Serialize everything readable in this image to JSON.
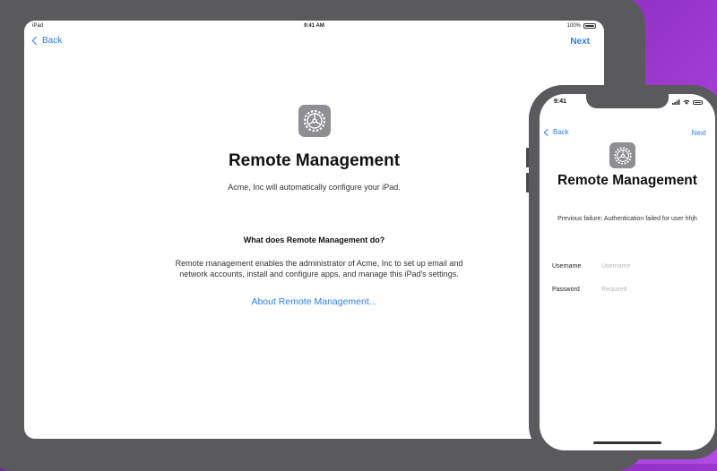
{
  "ipad": {
    "status": {
      "device": "iPad",
      "time": "9:41 AM",
      "battery": "100%"
    },
    "nav": {
      "back": "Back",
      "next": "Next"
    },
    "icon": "settings-gear-icon",
    "title": "Remote Management",
    "subtitle": "Acme, Inc will automatically configure your iPad.",
    "question": "What does Remote Management do?",
    "description": "Remote management enables the administrator of Acme, Inc to set up email and network accounts, install and configure apps, and manage this iPad's settings.",
    "link": "About Remote Management..."
  },
  "iphone": {
    "status": {
      "time": "9:41"
    },
    "nav": {
      "back": "Back",
      "next": "Next"
    },
    "icon": "settings-gear-icon",
    "title": "Remote Management",
    "failure": "Previous failure: Authentication failed for user hhjh",
    "fields": [
      {
        "label": "Username",
        "placeholder": "Username",
        "value": ""
      },
      {
        "label": "Password",
        "placeholder": "Required",
        "value": ""
      }
    ]
  },
  "colors": {
    "accent": "#2f7ef0",
    "background": "#8b2bc0",
    "device_frame": "#5a5a5c"
  }
}
